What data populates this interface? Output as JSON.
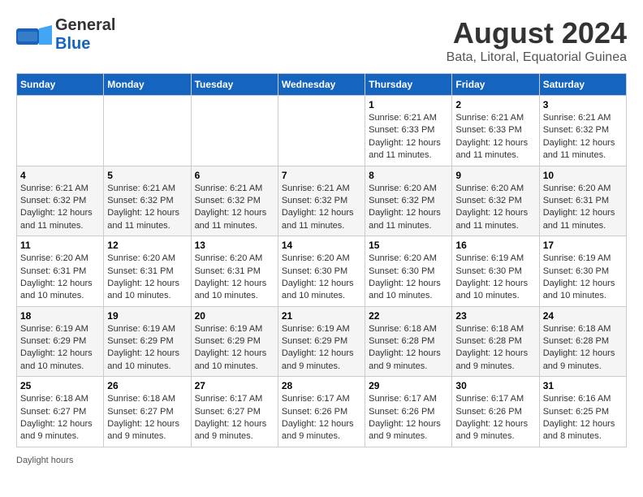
{
  "logo": {
    "line1": "General",
    "line2": "Blue"
  },
  "title": "August 2024",
  "subtitle": "Bata, Litoral, Equatorial Guinea",
  "days_of_week": [
    "Sunday",
    "Monday",
    "Tuesday",
    "Wednesday",
    "Thursday",
    "Friday",
    "Saturday"
  ],
  "weeks": [
    [
      {
        "day": "",
        "info": ""
      },
      {
        "day": "",
        "info": ""
      },
      {
        "day": "",
        "info": ""
      },
      {
        "day": "",
        "info": ""
      },
      {
        "day": "1",
        "sunrise": "6:21 AM",
        "sunset": "6:33 PM",
        "daylight": "12 hours and 11 minutes."
      },
      {
        "day": "2",
        "sunrise": "6:21 AM",
        "sunset": "6:33 PM",
        "daylight": "12 hours and 11 minutes."
      },
      {
        "day": "3",
        "sunrise": "6:21 AM",
        "sunset": "6:32 PM",
        "daylight": "12 hours and 11 minutes."
      }
    ],
    [
      {
        "day": "4",
        "sunrise": "6:21 AM",
        "sunset": "6:32 PM",
        "daylight": "12 hours and 11 minutes."
      },
      {
        "day": "5",
        "sunrise": "6:21 AM",
        "sunset": "6:32 PM",
        "daylight": "12 hours and 11 minutes."
      },
      {
        "day": "6",
        "sunrise": "6:21 AM",
        "sunset": "6:32 PM",
        "daylight": "12 hours and 11 minutes."
      },
      {
        "day": "7",
        "sunrise": "6:21 AM",
        "sunset": "6:32 PM",
        "daylight": "12 hours and 11 minutes."
      },
      {
        "day": "8",
        "sunrise": "6:20 AM",
        "sunset": "6:32 PM",
        "daylight": "12 hours and 11 minutes."
      },
      {
        "day": "9",
        "sunrise": "6:20 AM",
        "sunset": "6:32 PM",
        "daylight": "12 hours and 11 minutes."
      },
      {
        "day": "10",
        "sunrise": "6:20 AM",
        "sunset": "6:31 PM",
        "daylight": "12 hours and 11 minutes."
      }
    ],
    [
      {
        "day": "11",
        "sunrise": "6:20 AM",
        "sunset": "6:31 PM",
        "daylight": "12 hours and 10 minutes."
      },
      {
        "day": "12",
        "sunrise": "6:20 AM",
        "sunset": "6:31 PM",
        "daylight": "12 hours and 10 minutes."
      },
      {
        "day": "13",
        "sunrise": "6:20 AM",
        "sunset": "6:31 PM",
        "daylight": "12 hours and 10 minutes."
      },
      {
        "day": "14",
        "sunrise": "6:20 AM",
        "sunset": "6:30 PM",
        "daylight": "12 hours and 10 minutes."
      },
      {
        "day": "15",
        "sunrise": "6:20 AM",
        "sunset": "6:30 PM",
        "daylight": "12 hours and 10 minutes."
      },
      {
        "day": "16",
        "sunrise": "6:19 AM",
        "sunset": "6:30 PM",
        "daylight": "12 hours and 10 minutes."
      },
      {
        "day": "17",
        "sunrise": "6:19 AM",
        "sunset": "6:30 PM",
        "daylight": "12 hours and 10 minutes."
      }
    ],
    [
      {
        "day": "18",
        "sunrise": "6:19 AM",
        "sunset": "6:29 PM",
        "daylight": "12 hours and 10 minutes."
      },
      {
        "day": "19",
        "sunrise": "6:19 AM",
        "sunset": "6:29 PM",
        "daylight": "12 hours and 10 minutes."
      },
      {
        "day": "20",
        "sunrise": "6:19 AM",
        "sunset": "6:29 PM",
        "daylight": "12 hours and 10 minutes."
      },
      {
        "day": "21",
        "sunrise": "6:19 AM",
        "sunset": "6:29 PM",
        "daylight": "12 hours and 9 minutes."
      },
      {
        "day": "22",
        "sunrise": "6:18 AM",
        "sunset": "6:28 PM",
        "daylight": "12 hours and 9 minutes."
      },
      {
        "day": "23",
        "sunrise": "6:18 AM",
        "sunset": "6:28 PM",
        "daylight": "12 hours and 9 minutes."
      },
      {
        "day": "24",
        "sunrise": "6:18 AM",
        "sunset": "6:28 PM",
        "daylight": "12 hours and 9 minutes."
      }
    ],
    [
      {
        "day": "25",
        "sunrise": "6:18 AM",
        "sunset": "6:27 PM",
        "daylight": "12 hours and 9 minutes."
      },
      {
        "day": "26",
        "sunrise": "6:18 AM",
        "sunset": "6:27 PM",
        "daylight": "12 hours and 9 minutes."
      },
      {
        "day": "27",
        "sunrise": "6:17 AM",
        "sunset": "6:27 PM",
        "daylight": "12 hours and 9 minutes."
      },
      {
        "day": "28",
        "sunrise": "6:17 AM",
        "sunset": "6:26 PM",
        "daylight": "12 hours and 9 minutes."
      },
      {
        "day": "29",
        "sunrise": "6:17 AM",
        "sunset": "6:26 PM",
        "daylight": "12 hours and 9 minutes."
      },
      {
        "day": "30",
        "sunrise": "6:17 AM",
        "sunset": "6:26 PM",
        "daylight": "12 hours and 9 minutes."
      },
      {
        "day": "31",
        "sunrise": "6:16 AM",
        "sunset": "6:25 PM",
        "daylight": "12 hours and 8 minutes."
      }
    ]
  ],
  "footer": {
    "daylight_label": "Daylight hours"
  }
}
